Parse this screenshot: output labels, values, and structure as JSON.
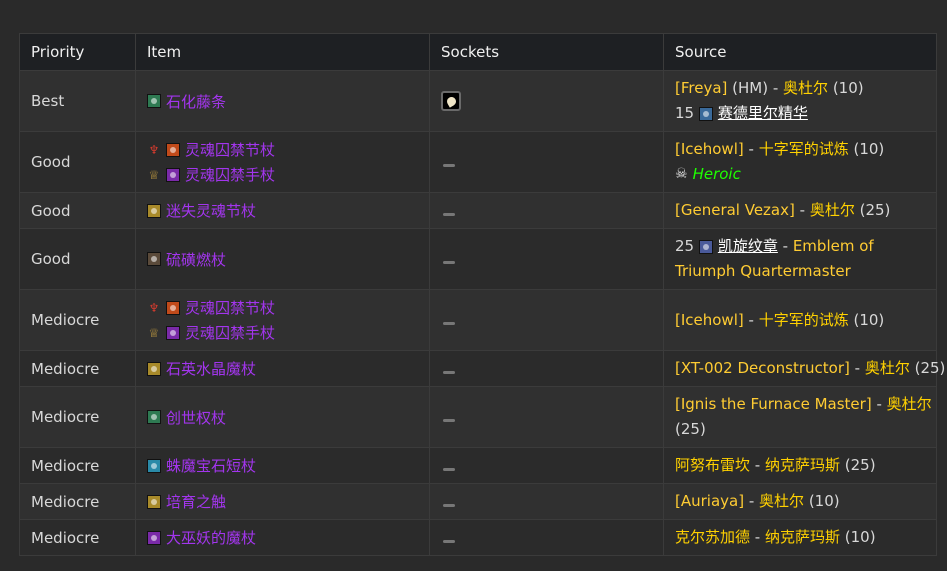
{
  "headers": {
    "priority": "Priority",
    "item": "Item",
    "sockets": "Sockets",
    "source": "Source"
  },
  "rows": [
    {
      "priority": "Best",
      "items": [
        {
          "name": "石化藤条",
          "icon": "green-gem-icon",
          "icon_color": "#2e7a52"
        }
      ],
      "socket": "meta-socket",
      "source": [
        [
          {
            "t": "[Freya]",
            "c": "link-gold"
          },
          {
            "t": " (HM) - ",
            "c": ""
          },
          {
            "t": "奥杜尔",
            "c": "gold"
          },
          {
            "t": " (10)",
            "c": ""
          }
        ],
        [
          {
            "t": "15 ",
            "c": ""
          },
          {
            "icon": "rune-of-sanctity-icon",
            "color": "#3a6a9a"
          },
          {
            "t": "赛德里尔精华",
            "c": "white-ul"
          }
        ]
      ]
    },
    {
      "priority": "Good",
      "items": [
        {
          "name": "灵魂囚禁节杖",
          "faction": "horde",
          "icon": "orange-staff-icon",
          "icon_color": "#c04a1a"
        },
        {
          "name": "灵魂囚禁手杖",
          "faction": "alliance",
          "icon": "purple-staff-icon",
          "icon_color": "#7a2aa8"
        }
      ],
      "socket": "none",
      "source": [
        [
          {
            "t": "[Icehowl]",
            "c": "link-gold"
          },
          {
            "t": " - ",
            "c": ""
          },
          {
            "t": "十字军的试炼",
            "c": "gold"
          },
          {
            "t": " (10)",
            "c": ""
          }
        ],
        [
          {
            "skull": "skull-icon"
          },
          {
            "t": "Heroic",
            "c": "heroic"
          }
        ]
      ]
    },
    {
      "priority": "Good",
      "items": [
        {
          "name": "迷失灵魂节杖",
          "icon": "yellow-staff-icon",
          "icon_color": "#a88a2a"
        }
      ],
      "socket": "none",
      "source": [
        [
          {
            "t": "[General Vezax]",
            "c": "link-gold"
          },
          {
            "t": " - ",
            "c": ""
          },
          {
            "t": "奥杜尔",
            "c": "gold"
          },
          {
            "t": " (25)",
            "c": ""
          }
        ]
      ]
    },
    {
      "priority": "Good",
      "items": [
        {
          "name": "硫磺燃杖",
          "icon": "dark-staff-icon",
          "icon_color": "#5a4a3a"
        }
      ],
      "socket": "none",
      "source": [
        [
          {
            "t": "25 ",
            "c": ""
          },
          {
            "icon": "emblem-of-triumph-icon",
            "color": "#4a5a9a"
          },
          {
            "t": "凯旋纹章",
            "c": "white-ul"
          },
          {
            "t": " - ",
            "c": ""
          },
          {
            "t": "Emblem of",
            "c": "link-gold"
          }
        ],
        [
          {
            "t": "Triumph Quartermaster",
            "c": "link-gold"
          }
        ]
      ]
    },
    {
      "priority": "Mediocre",
      "items": [
        {
          "name": "灵魂囚禁节杖",
          "faction": "horde",
          "icon": "orange-staff-icon",
          "icon_color": "#c04a1a"
        },
        {
          "name": "灵魂囚禁手杖",
          "faction": "alliance",
          "icon": "purple-staff-icon",
          "icon_color": "#7a2aa8"
        }
      ],
      "socket": "none",
      "source": [
        [
          {
            "t": "[Icehowl]",
            "c": "link-gold"
          },
          {
            "t": " - ",
            "c": ""
          },
          {
            "t": "十字军的试炼",
            "c": "gold"
          },
          {
            "t": " (10)",
            "c": ""
          }
        ]
      ]
    },
    {
      "priority": "Mediocre",
      "items": [
        {
          "name": "石英水晶魔杖",
          "icon": "yellow-staff-icon",
          "icon_color": "#a88a2a"
        }
      ],
      "socket": "none",
      "source": [
        [
          {
            "t": "[XT-002 Deconstructor]",
            "c": "link-gold"
          },
          {
            "t": " - ",
            "c": ""
          },
          {
            "t": "奥杜尔",
            "c": "gold"
          },
          {
            "t": " (25)",
            "c": ""
          }
        ]
      ]
    },
    {
      "priority": "Mediocre",
      "items": [
        {
          "name": "创世权杖",
          "icon": "green-gem-icon",
          "icon_color": "#2e7a52"
        }
      ],
      "socket": "none",
      "source": [
        [
          {
            "t": "[Ignis the Furnace Master]",
            "c": "link-gold"
          },
          {
            "t": " - ",
            "c": ""
          },
          {
            "t": "奥杜尔",
            "c": "gold"
          }
        ],
        [
          {
            "t": "(25)",
            "c": ""
          }
        ]
      ]
    },
    {
      "priority": "Mediocre",
      "items": [
        {
          "name": "蛛魔宝石短杖",
          "icon": "cyan-wand-icon",
          "icon_color": "#2a8aa8"
        }
      ],
      "socket": "none",
      "source": [
        [
          {
            "t": "阿努布雷坎",
            "c": "gold"
          },
          {
            "t": " - ",
            "c": ""
          },
          {
            "t": "纳克萨玛斯",
            "c": "gold"
          },
          {
            "t": " (25)",
            "c": ""
          }
        ]
      ]
    },
    {
      "priority": "Mediocre",
      "items": [
        {
          "name": "培育之触",
          "icon": "yellow-staff-icon",
          "icon_color": "#a88a2a"
        }
      ],
      "socket": "none",
      "source": [
        [
          {
            "t": "[Auriaya]",
            "c": "link-gold"
          },
          {
            "t": " - ",
            "c": ""
          },
          {
            "t": "奥杜尔",
            "c": "gold"
          },
          {
            "t": " (10)",
            "c": ""
          }
        ]
      ]
    },
    {
      "priority": "Mediocre",
      "items": [
        {
          "name": "大巫妖的魔杖",
          "icon": "purple-staff-icon",
          "icon_color": "#7a2aa8"
        }
      ],
      "socket": "none",
      "source": [
        [
          {
            "t": "克尔苏加德",
            "c": "gold"
          },
          {
            "t": " - ",
            "c": ""
          },
          {
            "t": "纳克萨玛斯",
            "c": "gold"
          },
          {
            "t": " (10)",
            "c": ""
          }
        ]
      ]
    }
  ]
}
